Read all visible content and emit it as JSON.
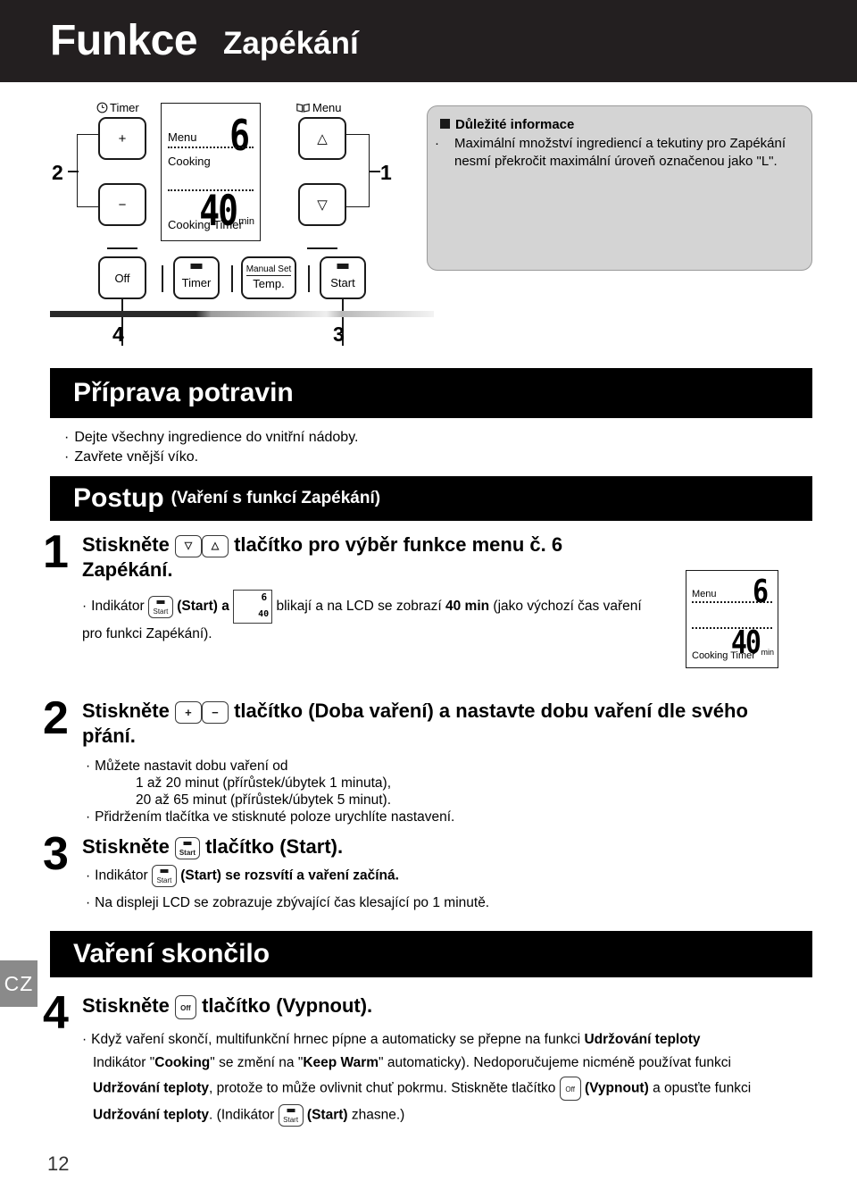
{
  "header": {
    "title_main": "Funkce",
    "title_sub": "Zapékání"
  },
  "side_tab": "CZ",
  "page_number": "12",
  "panel": {
    "timer_label": "Timer",
    "timer_icon": "clock-icon",
    "menu_label": "Menu",
    "menu_icon": "book-icon",
    "plus_button": "+",
    "minus_button": "−",
    "up_button": "△",
    "down_button": "▽",
    "off_button": "Off",
    "timer_button": "Timer",
    "manual_set_button_line1": "Manual Set",
    "manual_set_button_line2": "Temp.",
    "start_button": "Start",
    "callouts": {
      "one": "1",
      "two": "2",
      "three": "3",
      "four": "4"
    },
    "lcd": {
      "menu_label": "Menu",
      "cooking_label": "Cooking",
      "cooking_timer_label": "Cooking Timer",
      "menu_number": "6",
      "time_value": "40",
      "time_unit": "min"
    }
  },
  "info_box": {
    "title": "Důležité informace",
    "bullet": "·",
    "text": "Maximální množství ingrediencí a tekutiny pro Zapékání nesmí překročit maximální úroveň označenou jako \"L\"."
  },
  "prep_section": {
    "bar_title": "Příprava potravin",
    "bullets": [
      "Dejte všechny ingredience do vnitřní nádoby.",
      "Zavřete vnější víko."
    ]
  },
  "procedure_section": {
    "bar_title": "Postup",
    "bar_subtitle": "(Vaření s funkcí Zapékání)"
  },
  "steps": {
    "step1": {
      "number": "1",
      "head_pre": "Stiskněte",
      "head_post": "tlačítko pro výběr funkce menu č. 6 Zapékání.",
      "btn_down": "▽",
      "btn_up": "△",
      "sub_bullet": "·",
      "sub_a": "Indikátor",
      "sub_btn_start": "Start",
      "sub_b": "(Start) a",
      "sub_c": "blikají a na LCD se zobrazí",
      "sub_bold": "40 min",
      "sub_d": "(jako výchozí čas vaření pro funkci Zapékání).",
      "figure_lcd": {
        "menu_label": "Menu",
        "menu_number": "6",
        "time_value": "40",
        "time_unit": "min",
        "cooking_timer_label": "Cooking Timer"
      }
    },
    "step2": {
      "number": "2",
      "head_pre": "Stiskněte",
      "head_post": "tlačítko (Doba vaření) a nastavte dobu vaření dle svého přání.",
      "btn_plus": "+",
      "btn_minus": "−",
      "bullets": [
        "Můžete nastavit dobu vaření od",
        "Přidržením tlačítka ve stisknuté poloze urychlíte nastavení."
      ],
      "indented": [
        "1 až 20 minut (přírůstek/úbytek 1 minuta),",
        "20 až 65 minut (přírůstek/úbytek 5 minut)."
      ]
    },
    "step3": {
      "number": "3",
      "head_pre": "Stiskněte",
      "head_post": "tlačítko (Start).",
      "btn_start": "Start",
      "sub1_a": "Indikátor",
      "sub1_b": "(Start) se rozsvítí a vaření začíná.",
      "sub2": "Na displeji LCD se zobrazuje zbývající čas klesající po 1 minutě."
    },
    "step4": {
      "number": "4",
      "head_pre": "Stiskněte",
      "head_post": "tlačítko (Vypnout).",
      "btn_off": "Off",
      "para_l1_a": "Když vaření skončí, multifunkční hrnec pípne a automaticky se přepne na funkci",
      "para_l1_b": "Udržování teploty",
      "para_l2_a": "Indikátor \"",
      "para_l2_b": "Cooking",
      "para_l2_c": "\" se změní na \"",
      "para_l2_d": "Keep Warm",
      "para_l2_e": "\" automaticky). Nedoporučujeme nicméně používat funkci",
      "para_l3_a": "Udržování teploty",
      "para_l3_b": ", protože to může ovlivnit chuť pokrmu. Stiskněte tlačítko",
      "para_l3_c": "(Vypnout)",
      "para_l3_d": "a opusťte funkci",
      "para_l4_a": "Udržování teploty",
      "para_l4_b": ". (Indikátor",
      "para_l4_c": "(Start)",
      "para_l4_d": "zhasne.)",
      "btn_off_inline": "Off",
      "btn_start_inline": "Start"
    }
  },
  "finish_section": {
    "bar_title": "Vaření skončilo"
  },
  "colors": {
    "header_bg": "#231f20",
    "bar_bg": "#000000",
    "info_bg": "#d4d4d4",
    "tab_bg": "#8a8a8a"
  }
}
